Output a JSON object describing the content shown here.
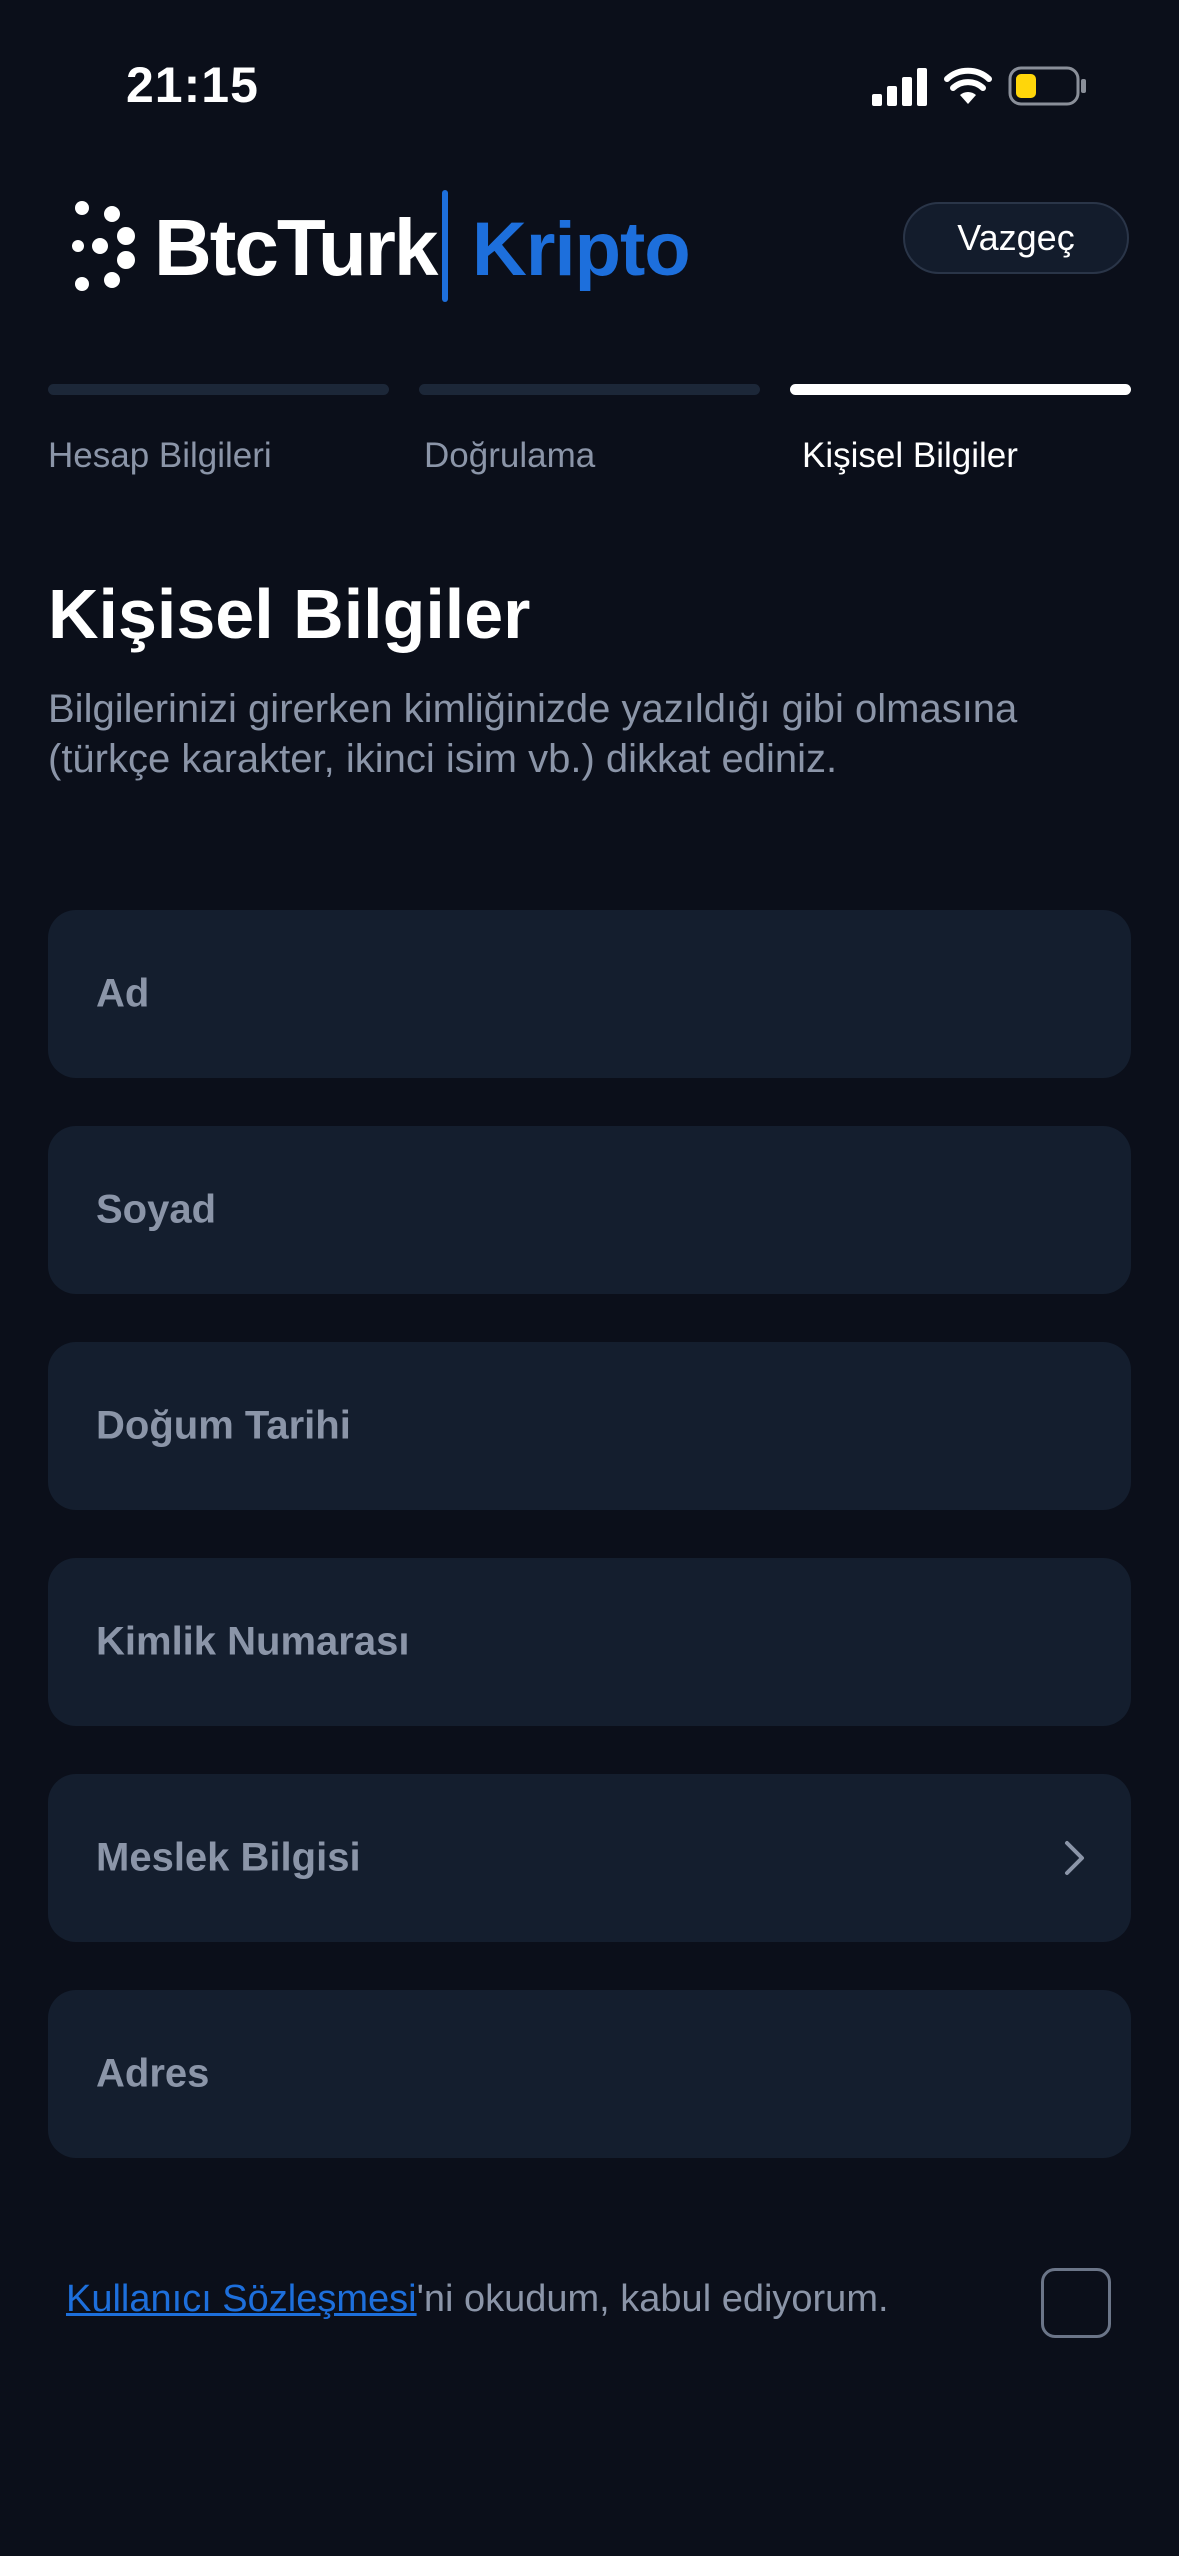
{
  "status_bar": {
    "time": "21:15",
    "icons": [
      "cellular-signal-icon",
      "wifi-icon",
      "battery-icon"
    ],
    "battery_color": "#ffd60a"
  },
  "header": {
    "logo_brand": "BtcTurk",
    "logo_product": "Kripto",
    "cancel_label": "Vazgeç"
  },
  "steps": [
    {
      "label": "Hesap Bilgileri",
      "active": false
    },
    {
      "label": "Doğrulama",
      "active": false
    },
    {
      "label": "Kişisel Bilgiler",
      "active": true
    }
  ],
  "page": {
    "title": "Kişisel Bilgiler",
    "description": "Bilgilerinizi girerken kimliğinizde yazıldığı gibi olmasına (türkçe karakter, ikinci isim vb.) dikkat ediniz."
  },
  "fields": [
    {
      "label": "Ad"
    },
    {
      "label": "Soyad"
    },
    {
      "label": "Doğum Tarihi"
    },
    {
      "label": "Kimlik Numarası"
    },
    {
      "label": "Meslek Bilgisi",
      "icon": "chevron-right-icon"
    },
    {
      "label": "Adres"
    }
  ],
  "agreement": {
    "link_text": "Kullanıcı Sözleşmesi",
    "rest_text": "'ni okudum, kabul ediyorum.",
    "checked": false
  },
  "colors": {
    "background": "#0b0f1a",
    "field_background": "#141e2e",
    "accent": "#1d6fdc",
    "muted_text": "#8b95a8"
  }
}
